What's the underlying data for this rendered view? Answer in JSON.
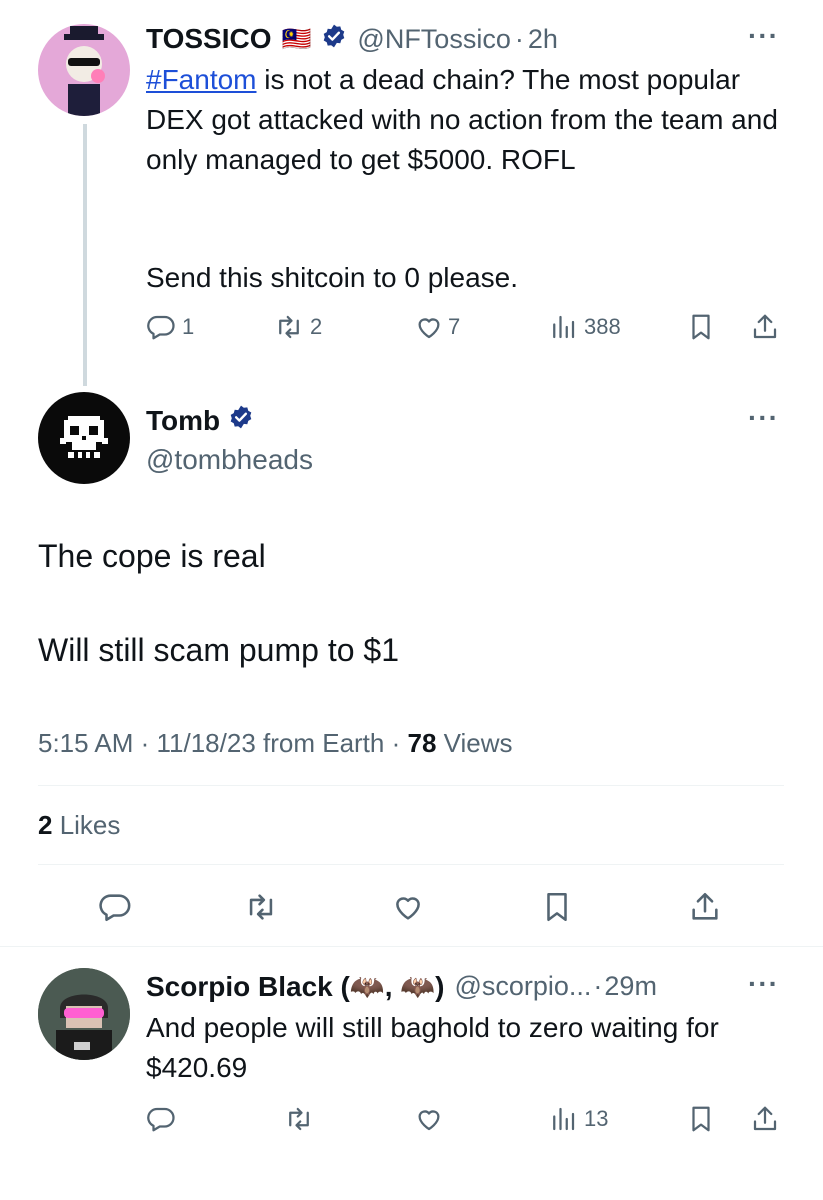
{
  "tweet1": {
    "display_name": "TOSSICO",
    "flag": "🇲🇾",
    "handle": "@NFTossico",
    "sep": "·",
    "time": "2h",
    "hashtag": "#Fantom",
    "text_after_hashtag": " is not a dead chain? The most popular DEX got attacked with no action from the team and only managed to get $5000. ROFL",
    "text_line2": "Send this shitcoin to 0 please.",
    "replies": "1",
    "retweets": "2",
    "likes": "7",
    "views": "388",
    "more": "···"
  },
  "tweet2": {
    "display_name": "Tomb",
    "handle": "@tombheads",
    "text_line1": "The cope is real",
    "text_line2": "Will still scam pump to $1",
    "timestamp": "5:15 AM · 11/18/23 from Earth · ",
    "views_count": "78",
    "views_label": " Views",
    "likes_count": "2",
    "likes_label": " Likes",
    "more": "···"
  },
  "tweet3": {
    "display_name": "Scorpio Black (🦇, 🦇)",
    "handle": "@scorpio...",
    "sep": "·",
    "time": "29m",
    "text": "And people will still baghold to zero waiting for $420.69",
    "views": "13",
    "more": "···"
  },
  "colors": {
    "text": "#0f1419",
    "muted": "#536471",
    "link": "#1d4fd8",
    "verified": "#1d9bf0",
    "divider": "#eff3f4"
  },
  "icons": [
    "reply-icon",
    "retweet-icon",
    "like-icon",
    "views-icon",
    "bookmark-icon",
    "share-icon",
    "verified-badge-icon",
    "more-icon"
  ]
}
